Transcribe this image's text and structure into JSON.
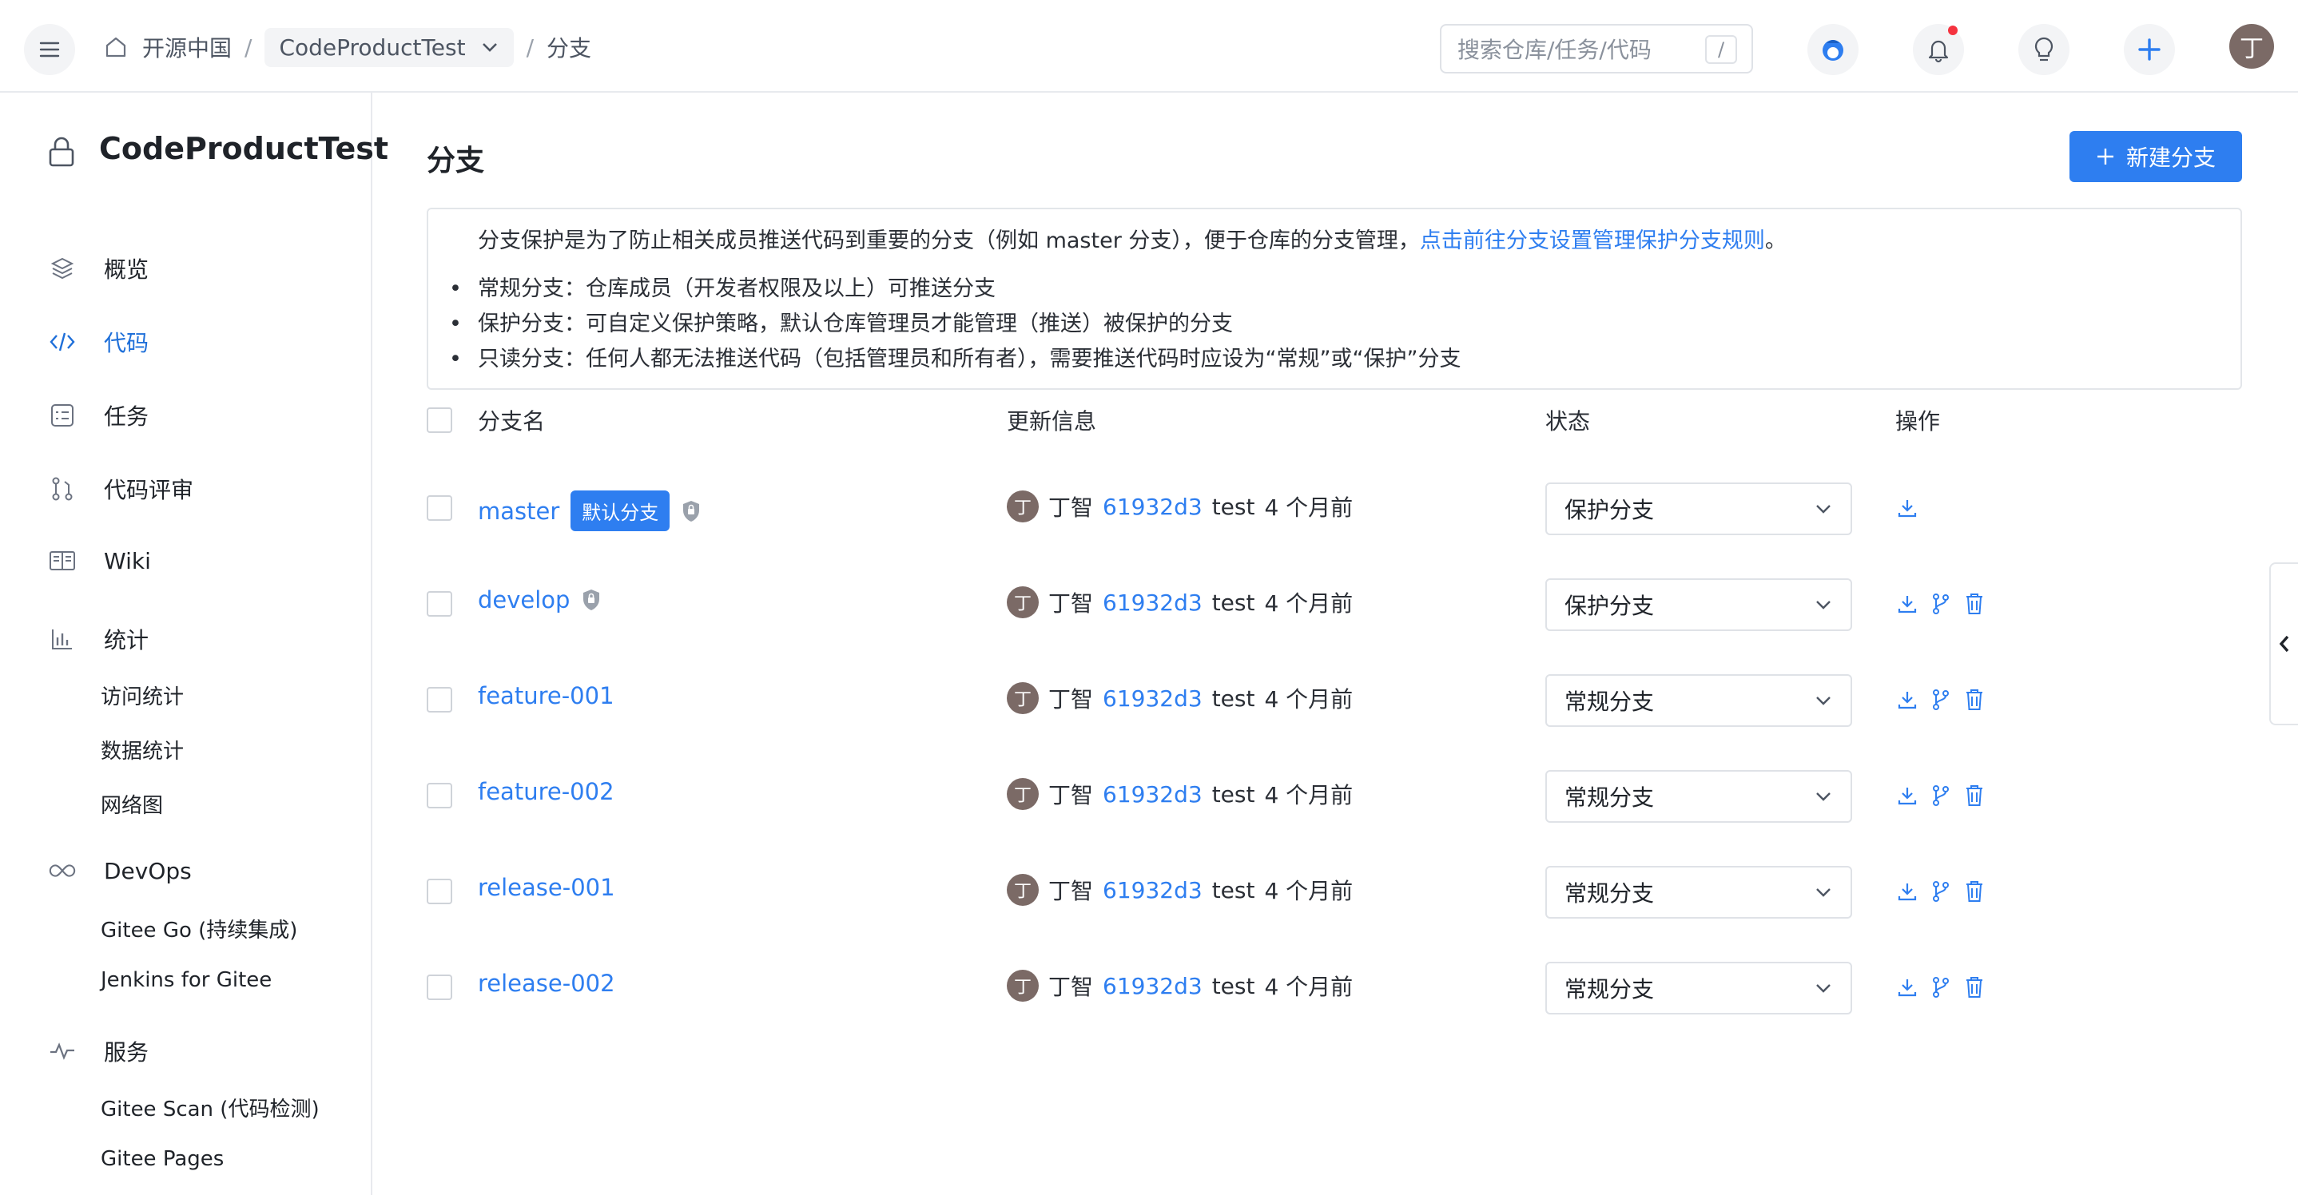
{
  "header": {
    "home_label": "开源中国",
    "repo_label": "CodeProductTest",
    "current_label": "分支",
    "search_placeholder": "搜索仓库/任务/代码",
    "search_shortcut": "/",
    "avatar_letter": "丁"
  },
  "sidebar": {
    "repo_name": "CodeProductTest",
    "items": [
      {
        "label": "概览"
      },
      {
        "label": "代码"
      },
      {
        "label": "任务"
      },
      {
        "label": "代码评审"
      },
      {
        "label": "Wiki"
      },
      {
        "label": "统计"
      },
      {
        "label": "DevOps"
      },
      {
        "label": "服务"
      }
    ],
    "stats_sub": [
      "访问统计",
      "数据统计",
      "网络图"
    ],
    "devops_sub": [
      "Gitee Go (持续集成)",
      "Jenkins for Gitee"
    ],
    "service_sub": [
      "Gitee Scan (代码检测)",
      "Gitee Pages"
    ]
  },
  "main": {
    "title": "分支",
    "new_branch_label": "新建分支",
    "notice": {
      "text": "分支保护是为了防止相关成员推送代码到重要的分支（例如 master 分支），便于仓库的分支管理，",
      "link": "点击前往分支设置管理保护分支规则",
      "end": "。",
      "bullets": [
        "常规分支：仓库成员（开发者权限及以上）可推送分支",
        "保护分支：可自定义保护策略，默认仓库管理员才能管理（推送）被保护的分支",
        "只读分支：任何人都无法推送代码（包括管理员和所有者），需要推送代码时应设为“常规”或“保护”分支"
      ]
    },
    "columns": {
      "name": "分支名",
      "update": "更新信息",
      "status": "状态",
      "ops": "操作"
    },
    "default_badge": "默认分支",
    "rows": [
      {
        "name": "master",
        "avatar": "丁",
        "author": "丁智",
        "commit": "61932d3",
        "message": "test",
        "time": "4 个月前",
        "status": "保护分支"
      },
      {
        "name": "develop",
        "avatar": "丁",
        "author": "丁智",
        "commit": "61932d3",
        "message": "test",
        "time": "4 个月前",
        "status": "保护分支"
      },
      {
        "name": "feature-001",
        "avatar": "丁",
        "author": "丁智",
        "commit": "61932d3",
        "message": "test",
        "time": "4 个月前",
        "status": "常规分支"
      },
      {
        "name": "feature-002",
        "avatar": "丁",
        "author": "丁智",
        "commit": "61932d3",
        "message": "test",
        "time": "4 个月前",
        "status": "常规分支"
      },
      {
        "name": "release-001",
        "avatar": "丁",
        "author": "丁智",
        "commit": "61932d3",
        "message": "test",
        "time": "4 个月前",
        "status": "常规分支"
      },
      {
        "name": "release-002",
        "avatar": "丁",
        "author": "丁智",
        "commit": "61932d3",
        "message": "test",
        "time": "4 个月前",
        "status": "常规分支"
      }
    ]
  },
  "colors": {
    "accent": "#2e7ef0",
    "notif_dot": "#f5333f",
    "avatar_bg": "#7b6a66"
  }
}
